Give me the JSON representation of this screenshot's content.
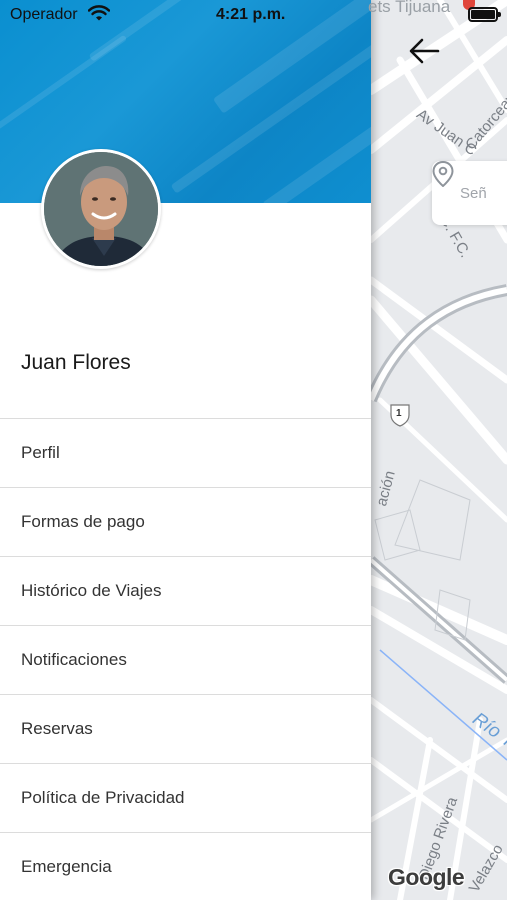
{
  "status_bar": {
    "carrier": "Operador",
    "time": "4:21 p.m.",
    "battery_level": 1.0
  },
  "map": {
    "top_label": "ets Tijuana",
    "search_placeholder": "Señ",
    "streets": [
      "Av Juan C",
      "Catorceava",
      "C. F.C.",
      "ación",
      "Diego Rivera",
      "Velazco"
    ],
    "river": "Río T",
    "highway_shield": "1",
    "logo": "Google",
    "colors": {
      "land": "#e8eaed",
      "road": "#ffffff",
      "park": "#cfe8cf",
      "water": "#8ab4f8"
    }
  },
  "drawer": {
    "cover_color": "#0a8fd0",
    "user_name": "Juan Flores",
    "menu": [
      {
        "label": "Perfil"
      },
      {
        "label": "Formas de pago"
      },
      {
        "label": "Histórico de Viajes"
      },
      {
        "label": "Notificaciones"
      },
      {
        "label": "Reservas"
      },
      {
        "label": "Política de Privacidad"
      },
      {
        "label": "Emergencia"
      }
    ]
  },
  "icons": {
    "back": "arrow-left-icon",
    "location": "location-pin-icon",
    "wifi": "wifi-icon",
    "battery": "battery-icon"
  }
}
